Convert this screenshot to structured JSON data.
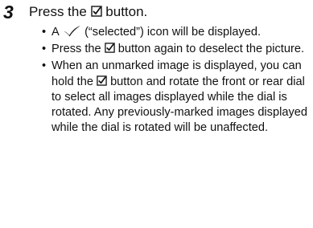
{
  "step": {
    "number": "3",
    "title_before": "Press the",
    "title_after": "button."
  },
  "bullets": [
    {
      "before": "A",
      "after": "(“selected”) icon will be displayed."
    },
    {
      "before": "Press the",
      "after": "button again to deselect the picture."
    },
    {
      "before": "When an unmarked image is displayed, you can hold the",
      "after": "button and rotate the front or rear dial to select all images displayed while the dial is rotated. Any previously-marked images displayed while the dial is rotated will be unaffected."
    }
  ],
  "icons": {
    "button": "checkbox-check-icon",
    "selected": "check-mark-icon"
  }
}
